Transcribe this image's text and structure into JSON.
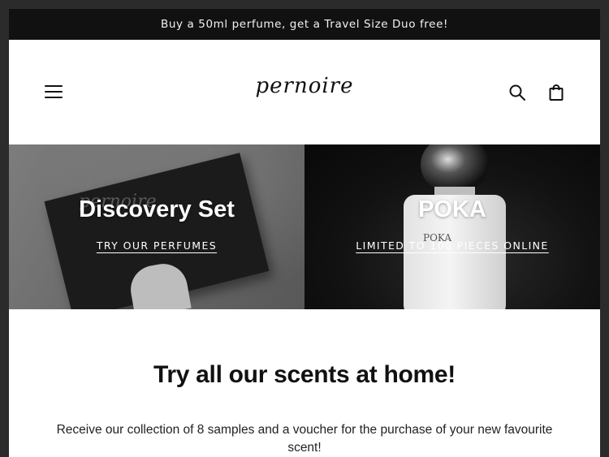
{
  "announcement": {
    "text": "Buy a 50ml perfume, get a Travel Size Duo free!"
  },
  "header": {
    "logo": "pernoire",
    "icons": {
      "menu": "menu-icon",
      "search": "search-icon",
      "cart": "shopping-bag-icon"
    }
  },
  "hero": {
    "tiles": [
      {
        "title": "Discovery Set",
        "link": "TRY OUR PERFUMES",
        "box_brand": "pernoire"
      },
      {
        "title": "POKA",
        "link": "LIMITED TO 100 PIECES ONLINE",
        "bottle_label": "POKA"
      }
    ]
  },
  "promo": {
    "title": "Try all our scents at home!",
    "text": "Receive our collection of 8 samples and a voucher for the purchase of your new favourite scent!"
  },
  "colors": {
    "announcement_bg": "#111111",
    "page_bg": "#ffffff",
    "text": "#111111"
  }
}
